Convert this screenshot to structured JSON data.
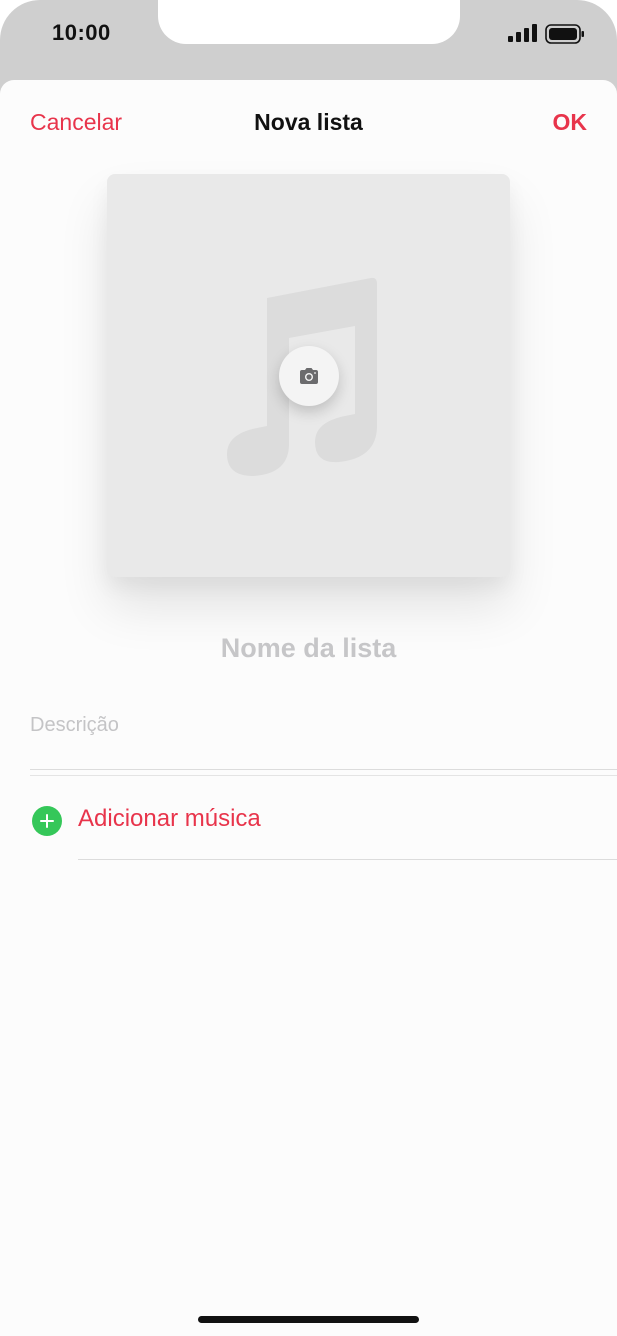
{
  "status_bar": {
    "time": "10:00",
    "icons": [
      "signal-icon",
      "battery-icon"
    ]
  },
  "nav": {
    "cancel_label": "Cancelar",
    "title": "Nova lista",
    "ok_label": "OK"
  },
  "artwork": {
    "icons": [
      "music-note-icon",
      "camera-icon"
    ]
  },
  "form": {
    "name_placeholder": "Nome da lista",
    "description_placeholder": "Descrição"
  },
  "add_music": {
    "label": "Adicionar música",
    "icon": "plus-circle-icon"
  },
  "colors": {
    "accent": "#e8344b",
    "add_green": "#35c759",
    "placeholder": "#c6c6c8"
  }
}
